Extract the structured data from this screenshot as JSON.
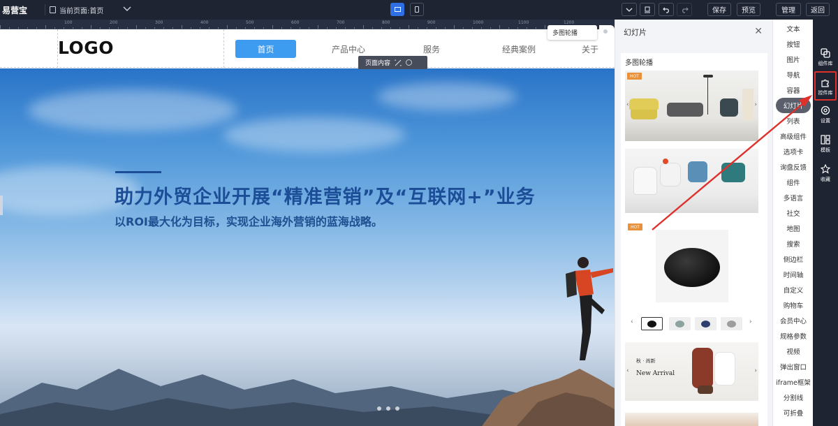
{
  "topbar": {
    "brand": "易营宝",
    "current_page": "当前页面:首页",
    "save": "保存",
    "preview": "预览",
    "manage": "管理",
    "back": "返回"
  },
  "ruler": {
    "labels": [
      "100",
      "200",
      "300",
      "400",
      "500",
      "600",
      "700",
      "800",
      "900",
      "1000",
      "1100",
      "1200"
    ]
  },
  "site": {
    "logo": "LOGO",
    "nav": [
      "首页",
      "产品中心",
      "服务",
      "经典案例",
      "关于"
    ],
    "page_content_label": "页面内容",
    "hero_title": "助力外贸企业开展“精准营销”及“互联网+”业务",
    "hero_subtitle": "以ROI最大化为目标，实现企业海外营销的蓝海战略。"
  },
  "tooltip": "多图轮播",
  "panel": {
    "title": "幻灯片",
    "section": "多图轮播",
    "hot": "HOT",
    "fashion_heading": "秋 · 尚新",
    "fashion_title": "New Arrival"
  },
  "categories": [
    "文本",
    "按钮",
    "图片",
    "导航",
    "容器",
    "幻灯片",
    "列表",
    "高级组件",
    "选项卡",
    "询盘反馈",
    "组件",
    "多语言",
    "社交",
    "地图",
    "搜索",
    "侧边栏",
    "时间轴",
    "自定义",
    "购物车",
    "会员中心",
    "规格参数",
    "视频",
    "弹出窗口",
    "iframe框架",
    "分割线",
    "可折叠"
  ],
  "active_category": "幻灯片",
  "rail": [
    "组件库",
    "控件库",
    "设置",
    "模板",
    "收藏"
  ],
  "colors": {
    "accent": "#3d9bf0",
    "hero_text": "#1c4e97",
    "hot": "#e8903a",
    "highlight": "#e0302b"
  }
}
